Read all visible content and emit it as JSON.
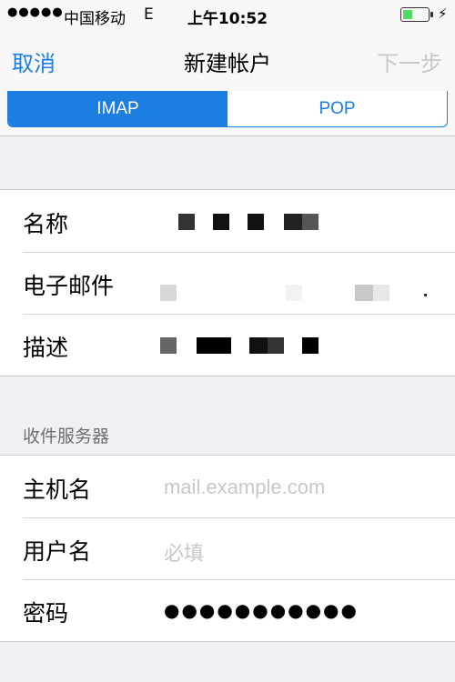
{
  "status_bar": {
    "signal": "●●●●●",
    "carrier": "中国移动",
    "network": "E",
    "time": "上午10:52",
    "battery_percent": 40,
    "charge_icon": "⚡"
  },
  "nav": {
    "cancel_label": "取消",
    "title": "新建帐户",
    "next_label": "下一步"
  },
  "segment": {
    "options": [
      "IMAP",
      "POP"
    ],
    "selected": "IMAP"
  },
  "account_group": {
    "rows": [
      {
        "label": "名称"
      },
      {
        "label": "电子邮件"
      },
      {
        "label": "描述"
      }
    ]
  },
  "incoming_server": {
    "header": "收件服务器",
    "rows": [
      {
        "label": "主机名",
        "placeholder": "mail.example.com"
      },
      {
        "label": "用户名",
        "placeholder": "必填"
      },
      {
        "label": "密码",
        "value": "●●●●●●●●●●●"
      }
    ]
  },
  "colors": {
    "accent": "#1b7ee0",
    "background": "#efeff4",
    "disabled": "#c8c8cc",
    "placeholder": "#c7c7cd",
    "battery": "#4cd964"
  }
}
